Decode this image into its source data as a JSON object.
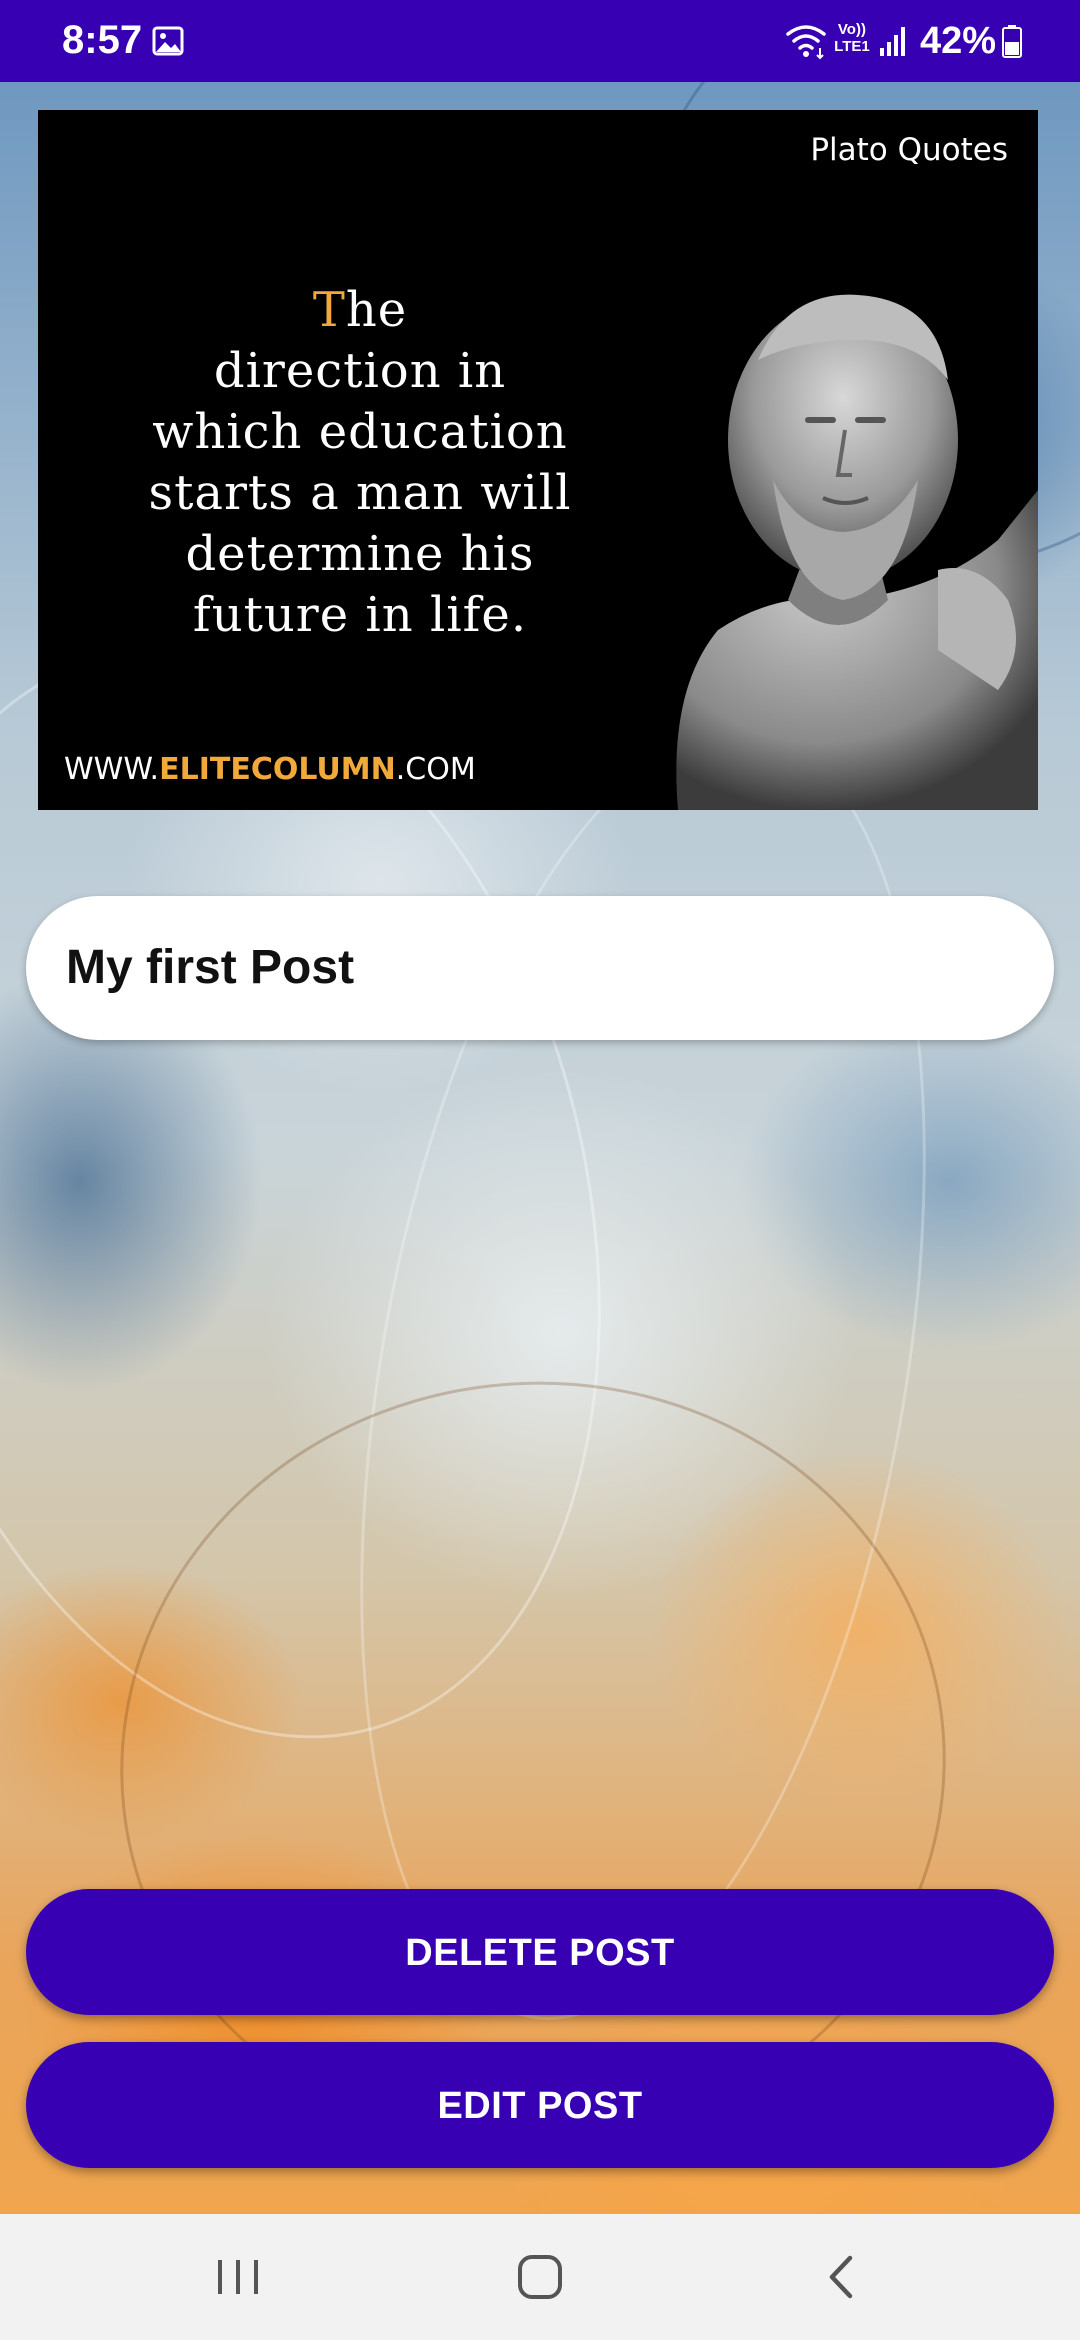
{
  "status_bar": {
    "time": "8:57",
    "volte_line1": "Vo))",
    "volte_line2": "LTE1",
    "battery": "42%",
    "icons": [
      "gallery-icon",
      "wifi-icon",
      "signal-icon",
      "battery-icon"
    ]
  },
  "post": {
    "image": {
      "brand": "Plato Quotes",
      "quote_first_letter": "T",
      "quote_rest_line1": "he",
      "quote_lines": [
        "direction in",
        "which education",
        "starts a man will",
        "determine his",
        "future in life."
      ],
      "website_prefix": "WWW.",
      "website_brand": "ELITECOLUMN",
      "website_suffix": ".COM"
    },
    "title": "My first Post"
  },
  "buttons": {
    "delete_label": "DELETE POST",
    "edit_label": "EDIT POST"
  },
  "nav_bar": {
    "icons": [
      "recents-icon",
      "home-icon",
      "back-icon"
    ]
  },
  "colors": {
    "primary": "#3700b3",
    "accent": "#f2a93b",
    "nav_background": "#f2f2f2"
  }
}
